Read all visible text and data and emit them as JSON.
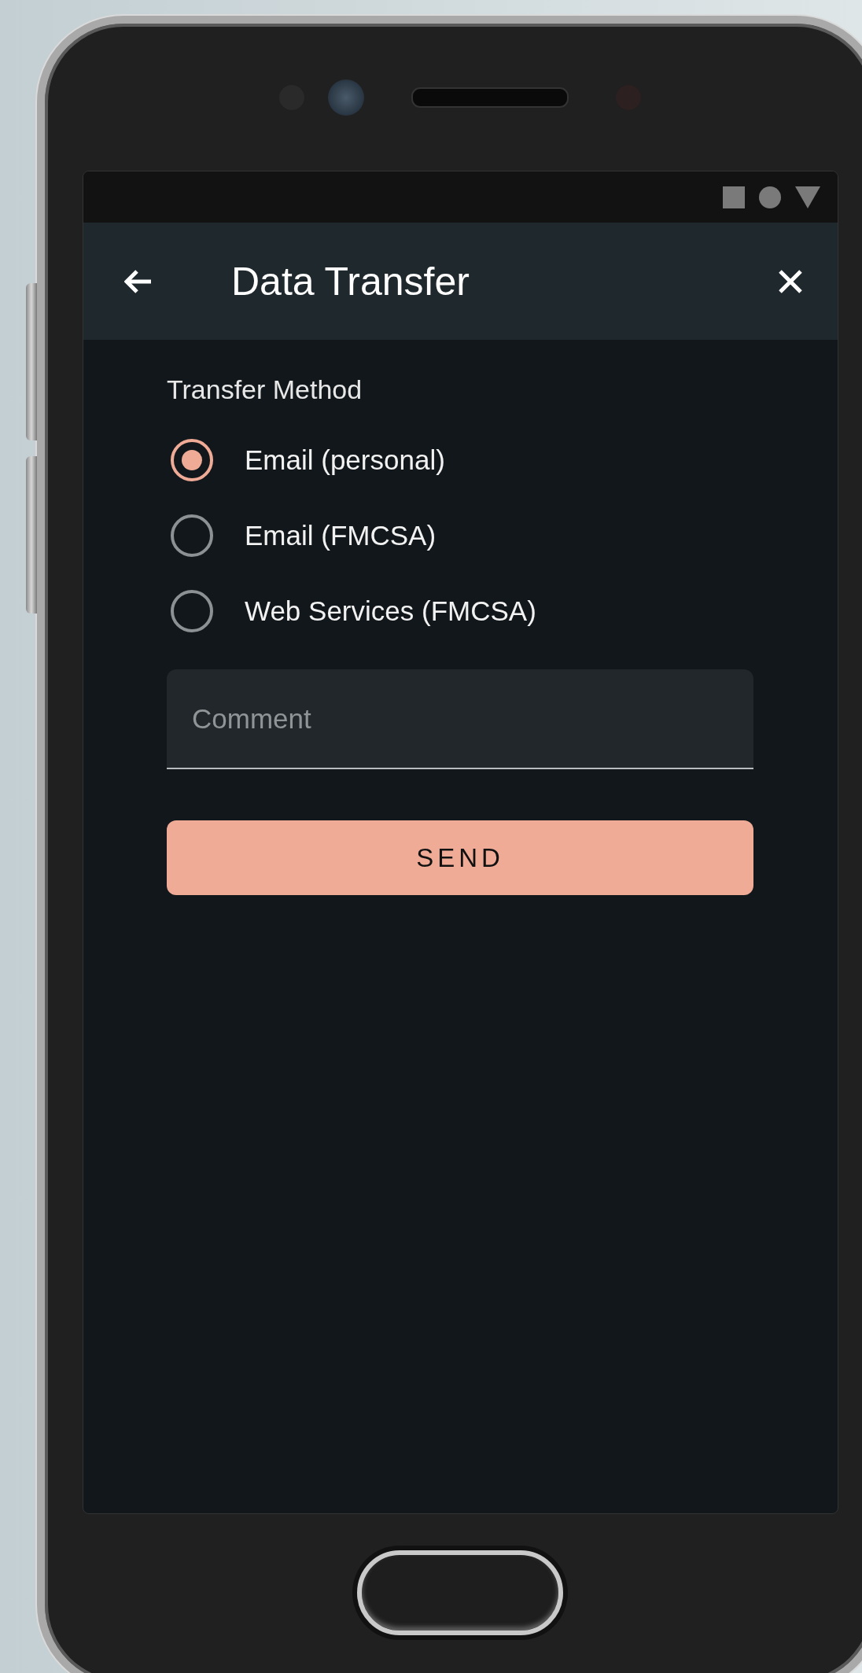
{
  "app_bar": {
    "title": "Data Transfer"
  },
  "form": {
    "label": "Transfer Method",
    "options": [
      {
        "label": "Email (personal)",
        "selected": true
      },
      {
        "label": "Email (FMCSA)",
        "selected": false
      },
      {
        "label": "Web Services (FMCSA)",
        "selected": false
      }
    ],
    "comment": {
      "placeholder": "Comment"
    },
    "submit": "SEND"
  }
}
